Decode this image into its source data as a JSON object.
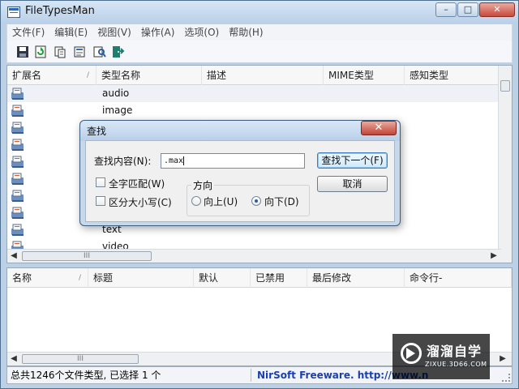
{
  "window": {
    "title": "FileTypesMan"
  },
  "window_controls": {
    "minimize": "–",
    "maximize": "□",
    "close": "✕"
  },
  "menu": [
    "文件(F)",
    "编辑(E)",
    "视图(V)",
    "操作(A)",
    "选项(O)",
    "帮助(H)"
  ],
  "toolbar": {
    "buttons": [
      "save-icon",
      "refresh-icon",
      "copy-icon",
      "properties-icon",
      "search-icon",
      "exit-icon"
    ]
  },
  "list": {
    "columns": [
      "扩展名",
      "类型名称",
      "描述",
      "MIME类型",
      "感知类型"
    ],
    "rows": [
      "audio",
      "image",
      "",
      "",
      "",
      "",
      "",
      "",
      "text",
      "video"
    ],
    "sort_indicator": "/"
  },
  "details": {
    "columns": [
      "名称",
      "标题",
      "默认",
      "已禁用",
      "最后修改",
      "命令行-"
    ],
    "sort_indicator": "/"
  },
  "scrollbars": {
    "grip": "III",
    "left_arrow": "◀",
    "right_arrow": "▶"
  },
  "status": {
    "left": "总共1246个文件类型, 已选择 1 个",
    "right": "NirSoft Freeware.  http://www.n"
  },
  "find_dialog": {
    "title": "查找",
    "close_label": "✕",
    "find_label": "查找内容(N):",
    "find_value": ".max",
    "find_next_button": "查找下一个(F)",
    "cancel_button": "取消",
    "match_whole_word": "全字匹配(W)",
    "match_case": "区分大小写(C)",
    "direction_label": "方向",
    "up_label": "向上(U)",
    "down_label": "向下(D)",
    "direction_selected": "down"
  },
  "watermark": {
    "name": "溜溜自学",
    "url": "ZIXUE.3D66.COM"
  },
  "colors": {
    "window_frame": "#bcd0e6",
    "selection": "#eef2f7",
    "status_link": "#1b3fb1",
    "dialog_frame": "#c7d8eb",
    "close_button": "#c24537"
  }
}
